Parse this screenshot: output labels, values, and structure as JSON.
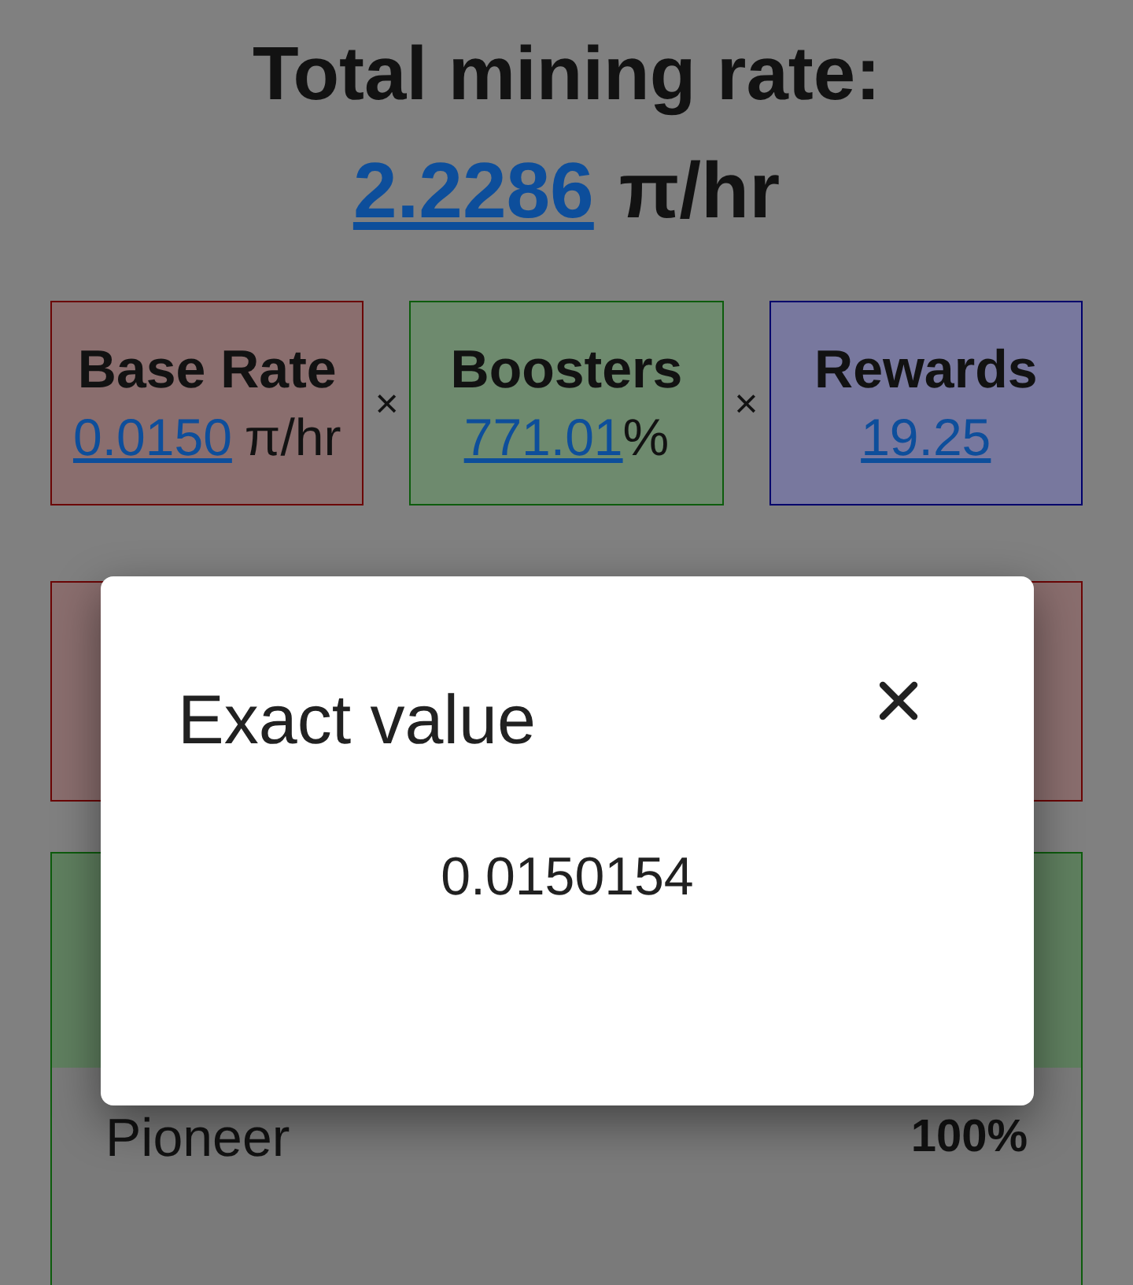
{
  "heading": "Total mining rate:",
  "total_rate": {
    "value": "2.2286",
    "unit": "π/hr"
  },
  "factors": [
    {
      "kind": "base",
      "label": "Base Rate",
      "value": "0.0150",
      "unit": "π/hr"
    },
    {
      "kind": "operator",
      "label": "×"
    },
    {
      "kind": "boosters",
      "label": "Boosters",
      "value": "771.01",
      "unit": "%"
    },
    {
      "kind": "operator",
      "label": "×"
    },
    {
      "kind": "rewards",
      "label": "Rewards",
      "value": "19.25"
    }
  ],
  "boosters_card": {
    "rows": [
      {
        "label": "Pioneer",
        "value": "100%"
      }
    ]
  },
  "dialog": {
    "title": "Exact value",
    "value": "0.0150154"
  }
}
